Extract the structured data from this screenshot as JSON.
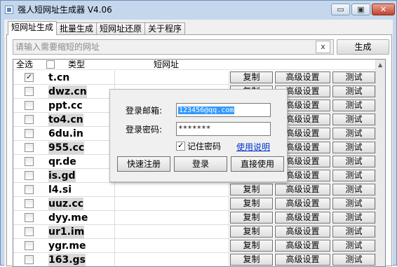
{
  "window": {
    "title": "强人短网址生成器 V4.06",
    "min_glyph": "▭",
    "max_glyph": "▣",
    "close_glyph": "✕"
  },
  "tabs": [
    {
      "label": "短网址生成",
      "active": true
    },
    {
      "label": "批量生成",
      "active": false
    },
    {
      "label": "短网址还原",
      "active": false
    },
    {
      "label": "关于程序",
      "active": false
    }
  ],
  "url_input": {
    "placeholder": "请输入需要缩短的网址",
    "value": ""
  },
  "clear_label": "x",
  "generate_label": "生成",
  "grid": {
    "headers": {
      "select_all": "全选",
      "type": "类型",
      "short_url": "短网址"
    },
    "rows": [
      {
        "type": "t.cn",
        "checked": true,
        "selected": false
      },
      {
        "type": "dwz.cn",
        "checked": false,
        "selected": true
      },
      {
        "type": "ppt.cc",
        "checked": false,
        "selected": false
      },
      {
        "type": "to4.cn",
        "checked": false,
        "selected": true
      },
      {
        "type": "6du.in",
        "checked": false,
        "selected": false
      },
      {
        "type": "955.cc",
        "checked": false,
        "selected": true
      },
      {
        "type": "qr.de",
        "checked": false,
        "selected": false
      },
      {
        "type": "is.gd",
        "checked": false,
        "selected": true
      },
      {
        "type": "l4.si",
        "checked": false,
        "selected": false
      },
      {
        "type": "uuz.cc",
        "checked": false,
        "selected": true
      },
      {
        "type": "dyy.me",
        "checked": false,
        "selected": false
      },
      {
        "type": "ur1.im",
        "checked": false,
        "selected": true
      },
      {
        "type": "ygr.me",
        "checked": false,
        "selected": false
      },
      {
        "type": "163.gs",
        "checked": false,
        "selected": true
      }
    ],
    "copy_label": "复制",
    "advanced_label": "高级设置",
    "test_label": "测试"
  },
  "login": {
    "email_label": "登录邮箱:",
    "email_value": "123456@qq.com",
    "password_label": "登录密码:",
    "password_value": "*******",
    "remember_label": "记住密码",
    "remember_checked": true,
    "help_label": "使用说明",
    "register_label": "快速注册",
    "login_label": "登录",
    "direct_label": "直接使用"
  }
}
